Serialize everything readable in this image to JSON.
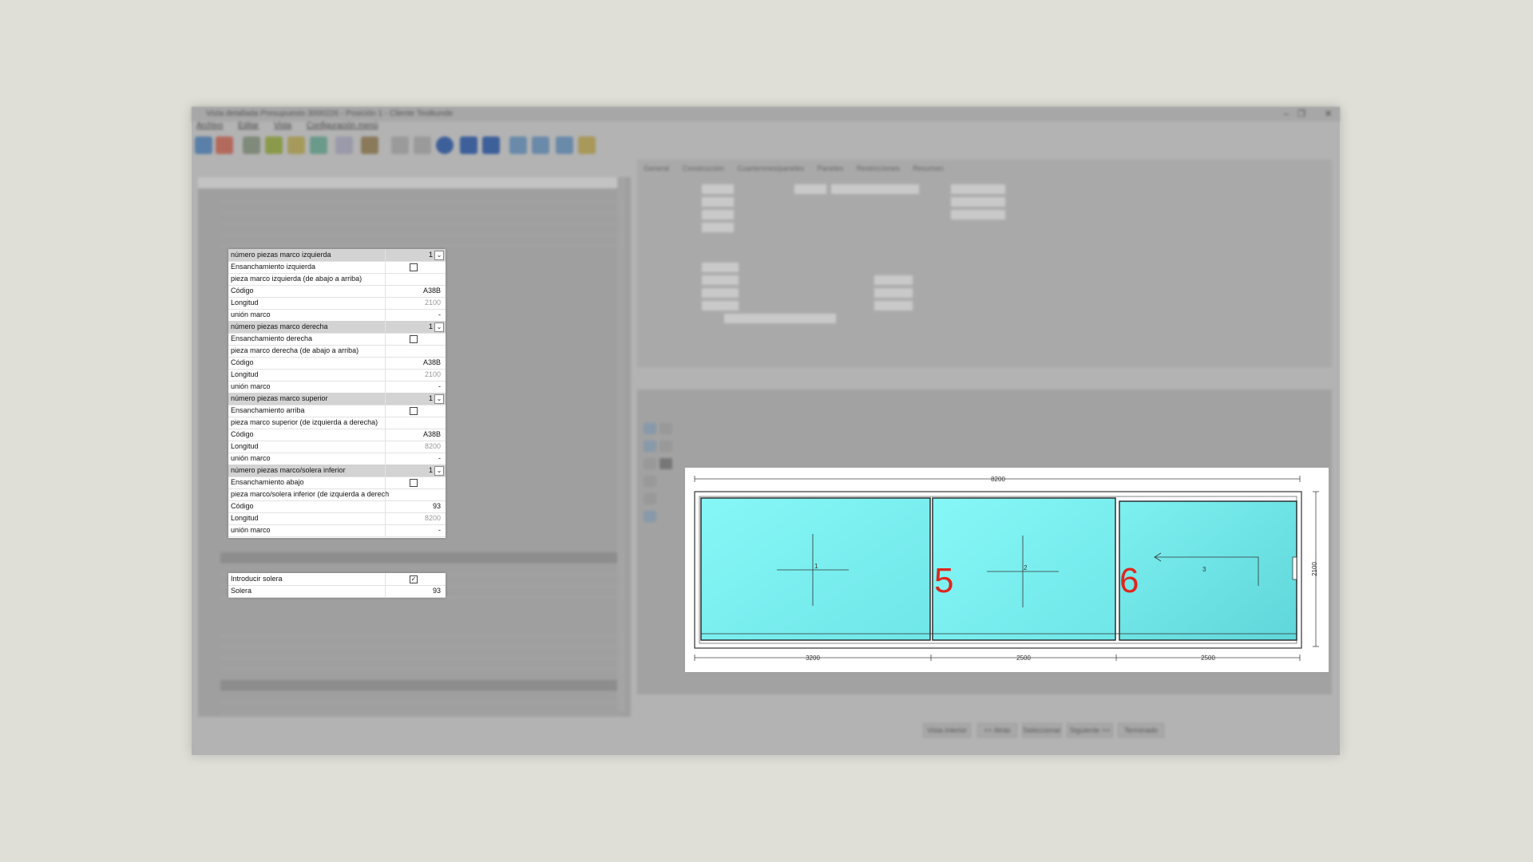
{
  "window": {
    "title": "Vista detallada Presupuesto 3000226 - Posición 1 - Cliente Testkunde",
    "menu": [
      "Archivo",
      "Editar",
      "Vista",
      "Configuración menú"
    ]
  },
  "right_tabs": [
    "General",
    "Construcción",
    "Cuarterones/paneles",
    "Paneles",
    "Restricciones",
    "Resumen"
  ],
  "properties_panel": {
    "rows": [
      {
        "label": "número piezas marco izquierda",
        "value": "1",
        "type": "group-dropdown"
      },
      {
        "label": "Ensanchamiento izquierda",
        "type": "checkbox",
        "checked": false
      },
      {
        "label": "pieza marco izquierda (de abajo a arriba)",
        "value": "",
        "type": "text"
      },
      {
        "label": "Código",
        "value": "A38B",
        "type": "text"
      },
      {
        "label": "Longitud",
        "value": "2100",
        "type": "muted"
      },
      {
        "label": "unión marco",
        "value": "-",
        "type": "text"
      },
      {
        "label": "número piezas marco derecha",
        "value": "1",
        "type": "group-dropdown"
      },
      {
        "label": "Ensanchamiento derecha",
        "type": "checkbox",
        "checked": false
      },
      {
        "label": "pieza marco derecha (de abajo a arriba)",
        "value": "",
        "type": "text"
      },
      {
        "label": "Código",
        "value": "A38B",
        "type": "text"
      },
      {
        "label": "Longitud",
        "value": "2100",
        "type": "muted"
      },
      {
        "label": "unión marco",
        "value": "-",
        "type": "text"
      },
      {
        "label": "número piezas marco superior",
        "value": "1",
        "type": "group-dropdown"
      },
      {
        "label": "Ensanchamiento arriba",
        "type": "checkbox",
        "checked": false
      },
      {
        "label": "pieza marco superior (de izquierda a derecha)",
        "value": "",
        "type": "text"
      },
      {
        "label": "Código",
        "value": "A38B",
        "type": "text"
      },
      {
        "label": "Longitud",
        "value": "8200",
        "type": "muted"
      },
      {
        "label": "unión marco",
        "value": "-",
        "type": "text"
      },
      {
        "label": "número piezas marco/solera inferior",
        "value": "1",
        "type": "group-dropdown"
      },
      {
        "label": "Ensanchamiento abajo",
        "type": "checkbox",
        "checked": false
      },
      {
        "label": "pieza marco/solera inferior (de izquierda a derech",
        "value": "",
        "type": "text"
      },
      {
        "label": "Código",
        "value": "93",
        "type": "text"
      },
      {
        "label": "Longitud",
        "value": "8200",
        "type": "muted"
      },
      {
        "label": "unión marco",
        "value": "-",
        "type": "text"
      }
    ],
    "solera_rows": [
      {
        "label": "Introducir solera",
        "type": "checkbox",
        "checked": true
      },
      {
        "label": "Solera",
        "value": "93",
        "type": "text"
      }
    ]
  },
  "drawing": {
    "total_width": "8200",
    "height": "2100",
    "segments": [
      "3200",
      "2500",
      "2500"
    ],
    "panels": [
      "1",
      "2",
      "3"
    ],
    "annotations": [
      "5",
      "6"
    ],
    "glass_color": "#76eeee"
  },
  "bottom_buttons": [
    "Vista interior",
    "<< Atrás",
    "Seleccionar",
    "Siguiente >>",
    "Terminado"
  ]
}
